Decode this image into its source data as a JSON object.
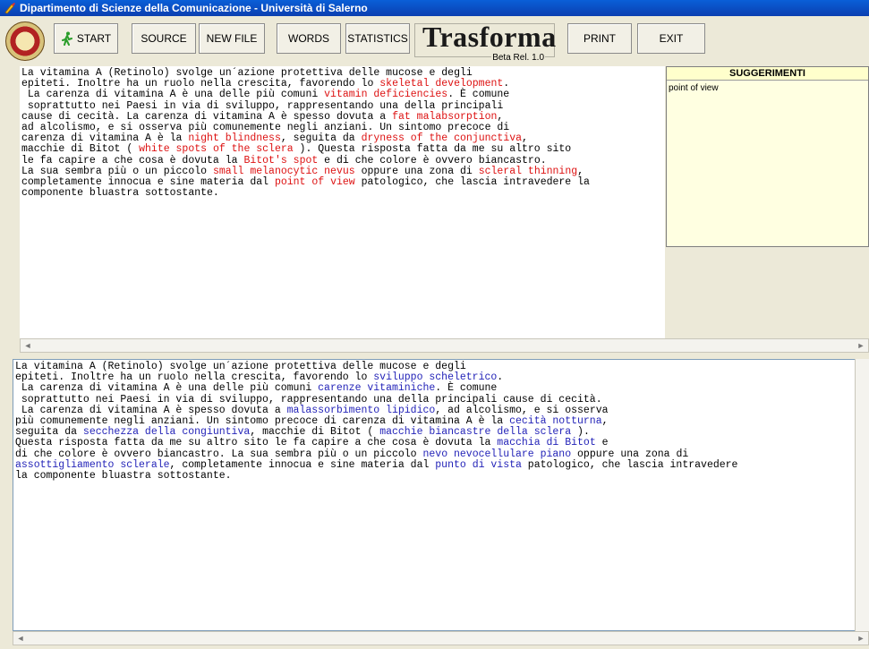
{
  "window": {
    "title": "Dipartimento di Scienze della Comunicazione - Università di Salerno"
  },
  "toolbar": {
    "start": "START",
    "source": "SOURCE",
    "new_file": "NEW FILE",
    "words": "WORDS",
    "statistics": "STATISTICS",
    "brand_name": "Trasforma",
    "brand_version": "Beta Rel. 1.0",
    "print": "PRINT",
    "exit": "EXIT"
  },
  "suggestions": {
    "header": "SUGGERIMENTI",
    "items": [
      "point of view"
    ]
  },
  "source_text": [
    [
      "La vitamina A (Retinolo) svolge un´azione protettiva delle mucose e degli"
    ],
    [
      "epiteti. Inoltre ha un ruolo nella crescita, favorendo lo ",
      {
        "t": "skeletal development",
        "h": 1
      },
      "."
    ],
    [
      " La carenza di vitamina A è una delle più comuni ",
      {
        "t": "vitamin deficiencies",
        "h": 1
      },
      ". È comune"
    ],
    [
      " soprattutto nei Paesi in via di sviluppo, rappresentando una della principali"
    ],
    [
      "cause di cecità. La carenza di vitamina A è spesso dovuta a ",
      {
        "t": "fat malabsorption",
        "h": 1
      },
      ","
    ],
    [
      "ad alcolismo, e si osserva più comunemente negli anziani. Un sintomo precoce di"
    ],
    [
      "carenza di vitamina A è la ",
      {
        "t": "night blindness",
        "h": 1
      },
      ", seguita da ",
      {
        "t": "dryness of the conjunctiva",
        "h": 1
      },
      ","
    ],
    [
      "macchie di Bitot ( ",
      {
        "t": "white spots of the sclera",
        "h": 1
      },
      " ). Questa risposta fatta da me su altro sito"
    ],
    [
      "le fa capire a che cosa è dovuta la ",
      {
        "t": "Bitot's spot",
        "h": 1
      },
      " e di che colore è ovvero biancastro."
    ],
    [
      "La sua sembra più o un piccolo ",
      {
        "t": "small melanocytic nevus",
        "h": 1
      },
      " oppure una zona di ",
      {
        "t": "scleral thinning",
        "h": 1
      },
      ","
    ],
    [
      "completamente innocua e sine materia dal ",
      {
        "t": "point of view",
        "h": 1
      },
      " patologico, che lascia intravedere la"
    ],
    [
      "componente bluastra sottostante."
    ]
  ],
  "translated_text": [
    [
      "La vitamina A (Retinolo) svolge un´azione protettiva delle mucose e degli"
    ],
    [
      "epiteti. Inoltre ha un ruolo nella crescita, favorendo lo ",
      {
        "t": "sviluppo scheletrico",
        "h": 1
      },
      "."
    ],
    [
      " La carenza di vitamina A è una delle più comuni ",
      {
        "t": "carenze vitaminiche",
        "h": 1
      },
      ". È comune"
    ],
    [
      " soprattutto nei Paesi in via di sviluppo, rappresentando una della principali cause di cecità."
    ],
    [
      " La carenza di vitamina A è spesso dovuta a ",
      {
        "t": "malassorbimento lipidico",
        "h": 1
      },
      ", ad alcolismo, e si osserva"
    ],
    [
      "più comunemente negli anziani. Un sintomo precoce di carenza di vitamina A è la ",
      {
        "t": "cecità notturna",
        "h": 1
      },
      ","
    ],
    [
      "seguita da ",
      {
        "t": "secchezza della congiuntiva",
        "h": 1
      },
      ", macchie di Bitot ( ",
      {
        "t": "macchie biancastre della sclera",
        "h": 1
      },
      " )."
    ],
    [
      "Questa risposta fatta da me su altro sito le fa capire a che cosa è dovuta la ",
      {
        "t": "macchia di Bitot",
        "h": 1
      },
      " e"
    ],
    [
      "di che colore è ovvero biancastro. La sua sembra più o un piccolo ",
      {
        "t": "nevo nevocellulare piano",
        "h": 1
      },
      " oppure una zona di"
    ],
    [
      {
        "t": "assottigliamento sclerale",
        "h": 1
      },
      ", completamente innocua e sine materia dal ",
      {
        "t": "punto di vista",
        "h": 1
      },
      " patologico, che lascia intravedere"
    ],
    [
      "la componente bluastra sottostante."
    ]
  ]
}
